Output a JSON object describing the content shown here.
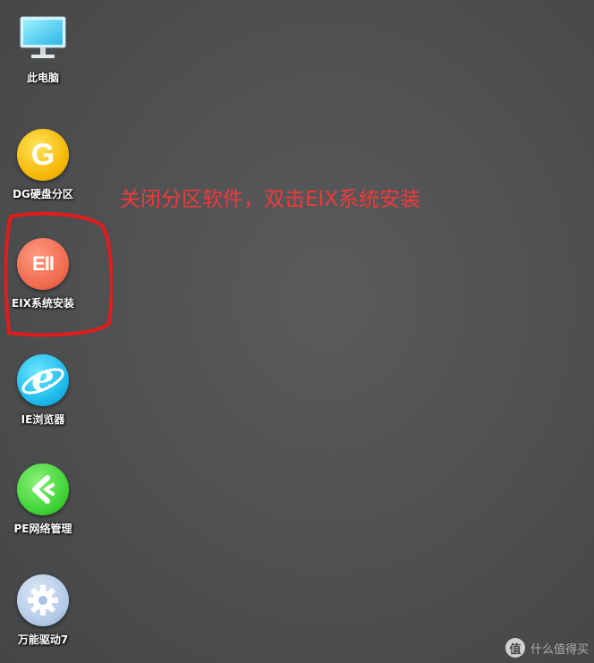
{
  "desktop": {
    "icons": [
      {
        "label": "此电脑",
        "icon": "computer-icon"
      },
      {
        "label": "DG硬盘分区",
        "icon": "diskgenius-icon",
        "glyph": "G"
      },
      {
        "label": "EIX系统安装",
        "icon": "eix-install-icon",
        "glyph": "EII"
      },
      {
        "label": "IE浏览器",
        "icon": "ie-browser-icon",
        "glyph": "e"
      },
      {
        "label": "PE网络管理",
        "icon": "pe-network-icon"
      },
      {
        "label": "万能驱动7",
        "icon": "driver-gear-icon"
      }
    ]
  },
  "annotation": {
    "text": "关闭分区软件，双击EIX系统安装",
    "color": "#f03a3a"
  },
  "watermark": {
    "badge": "值",
    "text": "什么值得买"
  },
  "colors": {
    "desktop_background": "#505153",
    "highlight_ring": "#e01c1c"
  }
}
